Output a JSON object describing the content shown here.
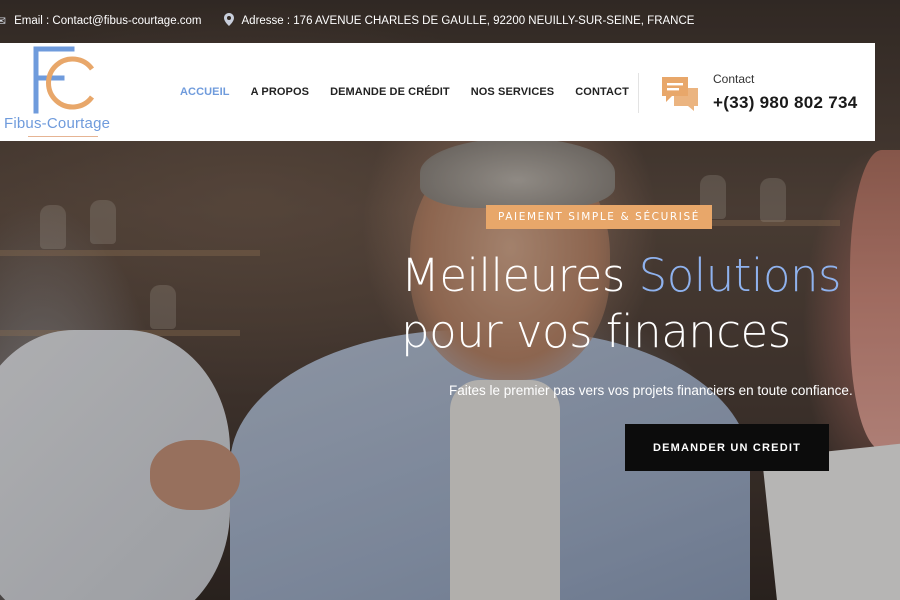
{
  "topbar": {
    "email_icon": "envelope-icon",
    "email": "Email : Contact@fibus-courtage.com",
    "address_icon": "location-pin-icon",
    "address": "Adresse : 176 AVENUE CHARLES DE GAULLE, 92200 NEUILLY-SUR-SEINE, FRANCE"
  },
  "logo": {
    "letters": "FC",
    "name": "Fibus-Courtage"
  },
  "nav": {
    "items": [
      {
        "label": "ACCUEIL",
        "active": true
      },
      {
        "label": "A PROPOS"
      },
      {
        "label": "DEMANDE DE CRÉDIT"
      },
      {
        "label": "NOS SERVICES"
      },
      {
        "label": "CONTACT"
      }
    ]
  },
  "contact": {
    "icon": "chat-bubbles-icon",
    "label": "Contact",
    "phone": "+(33) 980 802 734"
  },
  "hero": {
    "badge": "PAIEMENT SIMPLE & SÉCURISÉ",
    "headline_part1": "Meilleures ",
    "headline_accent": "Solutions",
    "headline_line2": "pour vos finances",
    "subtitle": "Faites le premier pas vers vos projets financiers en toute confiance.",
    "cta": "DEMANDER UN CREDIT"
  },
  "colors": {
    "accent_blue": "#6f9bdc",
    "accent_orange": "#e8a76a",
    "cta_bg": "#0c0c0c"
  }
}
